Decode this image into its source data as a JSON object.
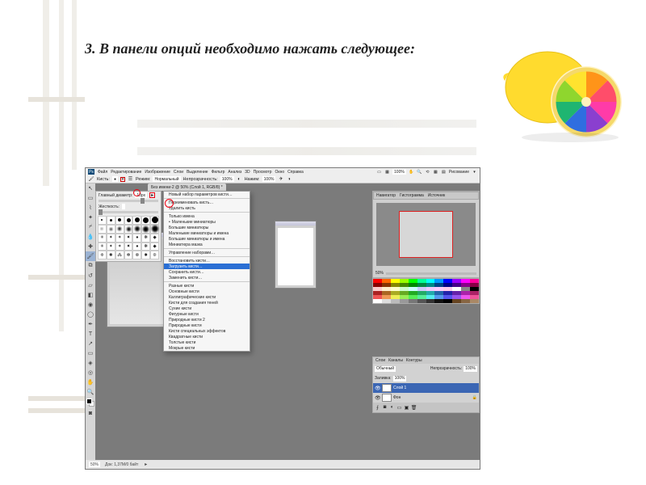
{
  "heading": "3. В панели опций необходимо нажать следующее:",
  "app": {
    "logo": "Ps",
    "menu": [
      "Файл",
      "Редактирование",
      "Изображение",
      "Слои",
      "Выделение",
      "Фильтр",
      "Анализ",
      "3D",
      "Просмотр",
      "Окно",
      "Справка"
    ],
    "zoom_field": "100%",
    "workspace": "Рисование",
    "options": {
      "label_brush": "Кисть:",
      "label_mode": "Режим:",
      "mode_value": "Нормальный",
      "label_opacity": "Непрозрачность:",
      "opacity_value": "100%",
      "label_flow": "Нажим:",
      "flow_value": "100%"
    },
    "doc_tab": "Без имени-2 @ 50% (Слой 1, RGB/8) *",
    "brush_panel": {
      "label_diameter": "Главный диаметр:",
      "label_hardness": "Жесткость:",
      "diameter": "18",
      "hardness_unit": "px"
    },
    "dropdown": {
      "items_1": [
        "Новый набор параметров кисти…"
      ],
      "items_2": [
        "Переименовать кисть…",
        "Удалить кисть"
      ],
      "items_3": [
        "Только имена",
        "Маленькие миниатюры",
        "Большие миниатюры",
        "Маленькие миниатюры и имена",
        "Большие миниатюры и имена",
        "Миниатюра мазка"
      ],
      "items_4": [
        "Управление наборами…"
      ],
      "highlighted": "Загрузить кисти…",
      "items_5": [
        "Восстановить кисти…",
        "Сохранить кисти…",
        "Заменить кисти…"
      ],
      "items_6": [
        "Разные кисти",
        "Основные кисти",
        "Каллиграфические кисти",
        "Кисти для создания теней",
        "Сухие кисти",
        "Фигурные кисти",
        "Природные кисти 2",
        "Природные кисти",
        "Кисти специальных эффектов",
        "Квадратные кисти",
        "Толстые кисти",
        "Мокрые кисти"
      ]
    },
    "right_panels": {
      "nav_tabs": [
        "Навигатор",
        "Гистограмма",
        "Источник"
      ],
      "layers_tabs": [
        "Слои",
        "Каналы",
        "Контуры"
      ],
      "blend_label": "Обычный",
      "opacity_label": "Непрозрачность:",
      "opacity_val": "100%",
      "fill_label": "Заливка:",
      "fill_val": "100%",
      "layer_1": "Слой 1",
      "layer_bg": "Фон"
    },
    "status": {
      "zoom": "50%",
      "doc_info": "Док: 1,37M/0 байт"
    }
  }
}
